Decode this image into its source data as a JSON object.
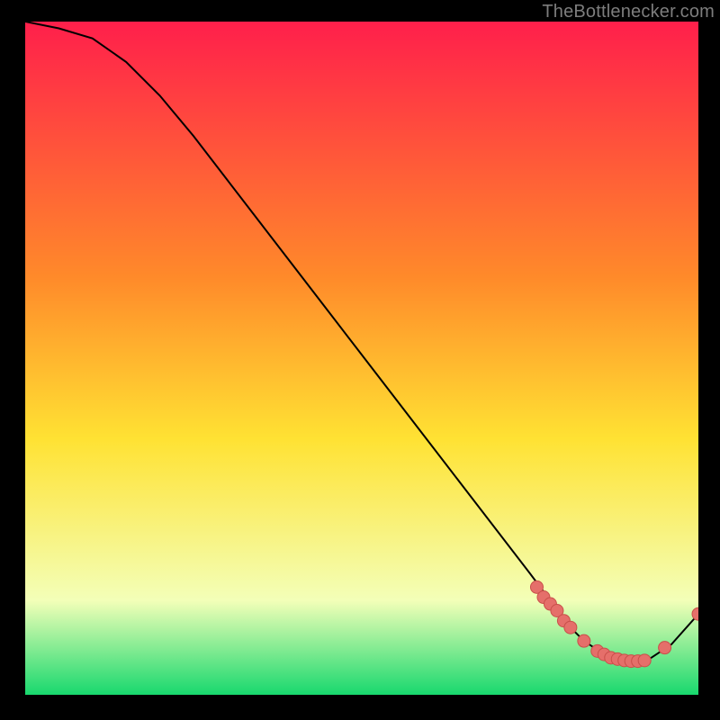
{
  "watermark": "TheBottlenecker.com",
  "chart_data": {
    "type": "line",
    "title": "",
    "xlabel": "",
    "ylabel": "",
    "xlim": [
      0,
      100
    ],
    "ylim": [
      0,
      100
    ],
    "series": [
      {
        "name": "curve",
        "x": [
          0,
          5,
          10,
          15,
          20,
          25,
          30,
          35,
          40,
          45,
          50,
          55,
          60,
          65,
          70,
          75,
          78,
          80,
          83,
          86,
          90,
          93,
          96,
          100
        ],
        "y": [
          100,
          99,
          97.5,
          94,
          89,
          83,
          76.5,
          70,
          63.5,
          57,
          50.5,
          44,
          37.5,
          31,
          24.5,
          18,
          14,
          11,
          8,
          6,
          5,
          5.5,
          7.5,
          12
        ]
      }
    ],
    "markers": {
      "name": "points",
      "x": [
        76,
        77,
        78,
        79,
        80,
        81,
        83,
        85,
        86,
        87,
        88,
        89,
        90,
        91,
        92,
        95,
        100
      ],
      "y": [
        16,
        14.5,
        13.5,
        12.5,
        11,
        10,
        8,
        6.5,
        6,
        5.5,
        5.3,
        5.1,
        5,
        5,
        5.1,
        7,
        12
      ]
    },
    "colors": {
      "gradient_top": "#ff1f4b",
      "gradient_mid_top": "#ff8a2a",
      "gradient_mid": "#ffe233",
      "gradient_mid_low": "#f3ffb8",
      "gradient_low": "#18d86e",
      "curve": "#000000",
      "marker_fill": "#e56f6a",
      "marker_stroke": "#c94f4a"
    }
  }
}
